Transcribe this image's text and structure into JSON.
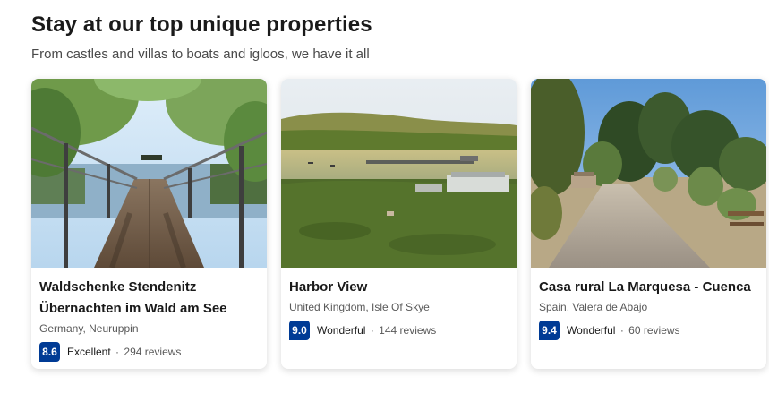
{
  "section": {
    "title": "Stay at our top unique properties",
    "subtitle": "From castles and villas to boats and igloos, we have it all"
  },
  "properties": [
    {
      "name": "Waldschenke Stendenitz Übernachten im Wald am See",
      "location": "Germany, Neuruppin",
      "score": "8.6",
      "rating_word": "Excellent",
      "separator": "·",
      "reviews": "294 reviews"
    },
    {
      "name": "Harbor View",
      "location": "United Kingdom, Isle Of Skye",
      "score": "9.0",
      "rating_word": "Wonderful",
      "separator": "·",
      "reviews": "144 reviews"
    },
    {
      "name": "Casa rural La Marquesa - Cuenca",
      "location": "Spain, Valera de Abajo",
      "score": "9.4",
      "rating_word": "Wonderful",
      "separator": "·",
      "reviews": "60 reviews"
    }
  ],
  "colors": {
    "score_badge": "#003b95",
    "text_primary": "#1a1a1a",
    "text_secondary": "#595959"
  }
}
